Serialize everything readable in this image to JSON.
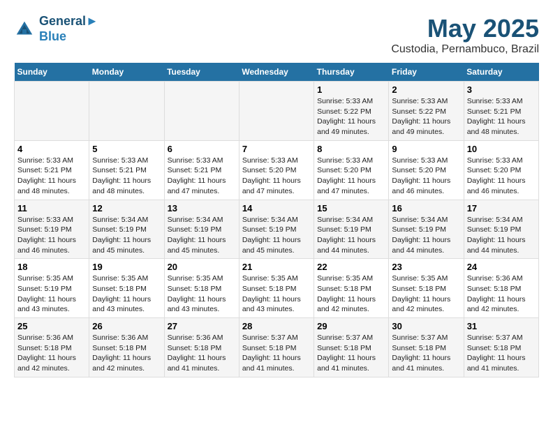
{
  "logo": {
    "line1": "General",
    "line2": "Blue"
  },
  "title": "May 2025",
  "subtitle": "Custodia, Pernambuco, Brazil",
  "days_of_week": [
    "Sunday",
    "Monday",
    "Tuesday",
    "Wednesday",
    "Thursday",
    "Friday",
    "Saturday"
  ],
  "weeks": [
    [
      {
        "day": "",
        "info": ""
      },
      {
        "day": "",
        "info": ""
      },
      {
        "day": "",
        "info": ""
      },
      {
        "day": "",
        "info": ""
      },
      {
        "day": "1",
        "info": "Sunrise: 5:33 AM\nSunset: 5:22 PM\nDaylight: 11 hours\nand 49 minutes."
      },
      {
        "day": "2",
        "info": "Sunrise: 5:33 AM\nSunset: 5:22 PM\nDaylight: 11 hours\nand 49 minutes."
      },
      {
        "day": "3",
        "info": "Sunrise: 5:33 AM\nSunset: 5:21 PM\nDaylight: 11 hours\nand 48 minutes."
      }
    ],
    [
      {
        "day": "4",
        "info": "Sunrise: 5:33 AM\nSunset: 5:21 PM\nDaylight: 11 hours\nand 48 minutes."
      },
      {
        "day": "5",
        "info": "Sunrise: 5:33 AM\nSunset: 5:21 PM\nDaylight: 11 hours\nand 48 minutes."
      },
      {
        "day": "6",
        "info": "Sunrise: 5:33 AM\nSunset: 5:21 PM\nDaylight: 11 hours\nand 47 minutes."
      },
      {
        "day": "7",
        "info": "Sunrise: 5:33 AM\nSunset: 5:20 PM\nDaylight: 11 hours\nand 47 minutes."
      },
      {
        "day": "8",
        "info": "Sunrise: 5:33 AM\nSunset: 5:20 PM\nDaylight: 11 hours\nand 47 minutes."
      },
      {
        "day": "9",
        "info": "Sunrise: 5:33 AM\nSunset: 5:20 PM\nDaylight: 11 hours\nand 46 minutes."
      },
      {
        "day": "10",
        "info": "Sunrise: 5:33 AM\nSunset: 5:20 PM\nDaylight: 11 hours\nand 46 minutes."
      }
    ],
    [
      {
        "day": "11",
        "info": "Sunrise: 5:33 AM\nSunset: 5:19 PM\nDaylight: 11 hours\nand 46 minutes."
      },
      {
        "day": "12",
        "info": "Sunrise: 5:34 AM\nSunset: 5:19 PM\nDaylight: 11 hours\nand 45 minutes."
      },
      {
        "day": "13",
        "info": "Sunrise: 5:34 AM\nSunset: 5:19 PM\nDaylight: 11 hours\nand 45 minutes."
      },
      {
        "day": "14",
        "info": "Sunrise: 5:34 AM\nSunset: 5:19 PM\nDaylight: 11 hours\nand 45 minutes."
      },
      {
        "day": "15",
        "info": "Sunrise: 5:34 AM\nSunset: 5:19 PM\nDaylight: 11 hours\nand 44 minutes."
      },
      {
        "day": "16",
        "info": "Sunrise: 5:34 AM\nSunset: 5:19 PM\nDaylight: 11 hours\nand 44 minutes."
      },
      {
        "day": "17",
        "info": "Sunrise: 5:34 AM\nSunset: 5:19 PM\nDaylight: 11 hours\nand 44 minutes."
      }
    ],
    [
      {
        "day": "18",
        "info": "Sunrise: 5:35 AM\nSunset: 5:19 PM\nDaylight: 11 hours\nand 43 minutes."
      },
      {
        "day": "19",
        "info": "Sunrise: 5:35 AM\nSunset: 5:18 PM\nDaylight: 11 hours\nand 43 minutes."
      },
      {
        "day": "20",
        "info": "Sunrise: 5:35 AM\nSunset: 5:18 PM\nDaylight: 11 hours\nand 43 minutes."
      },
      {
        "day": "21",
        "info": "Sunrise: 5:35 AM\nSunset: 5:18 PM\nDaylight: 11 hours\nand 43 minutes."
      },
      {
        "day": "22",
        "info": "Sunrise: 5:35 AM\nSunset: 5:18 PM\nDaylight: 11 hours\nand 42 minutes."
      },
      {
        "day": "23",
        "info": "Sunrise: 5:35 AM\nSunset: 5:18 PM\nDaylight: 11 hours\nand 42 minutes."
      },
      {
        "day": "24",
        "info": "Sunrise: 5:36 AM\nSunset: 5:18 PM\nDaylight: 11 hours\nand 42 minutes."
      }
    ],
    [
      {
        "day": "25",
        "info": "Sunrise: 5:36 AM\nSunset: 5:18 PM\nDaylight: 11 hours\nand 42 minutes."
      },
      {
        "day": "26",
        "info": "Sunrise: 5:36 AM\nSunset: 5:18 PM\nDaylight: 11 hours\nand 42 minutes."
      },
      {
        "day": "27",
        "info": "Sunrise: 5:36 AM\nSunset: 5:18 PM\nDaylight: 11 hours\nand 41 minutes."
      },
      {
        "day": "28",
        "info": "Sunrise: 5:37 AM\nSunset: 5:18 PM\nDaylight: 11 hours\nand 41 minutes."
      },
      {
        "day": "29",
        "info": "Sunrise: 5:37 AM\nSunset: 5:18 PM\nDaylight: 11 hours\nand 41 minutes."
      },
      {
        "day": "30",
        "info": "Sunrise: 5:37 AM\nSunset: 5:18 PM\nDaylight: 11 hours\nand 41 minutes."
      },
      {
        "day": "31",
        "info": "Sunrise: 5:37 AM\nSunset: 5:18 PM\nDaylight: 11 hours\nand 41 minutes."
      }
    ]
  ]
}
